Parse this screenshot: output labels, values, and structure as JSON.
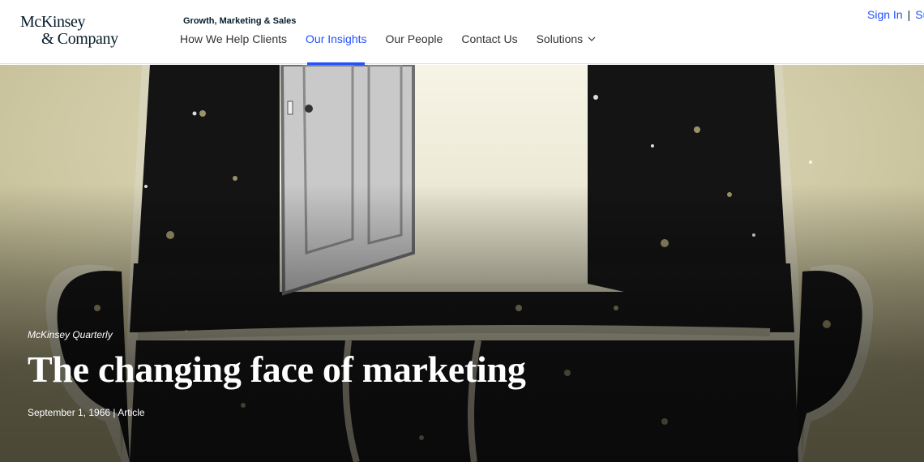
{
  "brand": {
    "logo_line1": "McKinsey",
    "logo_line2": "& Company"
  },
  "header": {
    "section_label": "Growth, Marketing & Sales",
    "nav": [
      {
        "label": "How We Help Clients",
        "active": false
      },
      {
        "label": "Our Insights",
        "active": true
      },
      {
        "label": "Our People",
        "active": false
      },
      {
        "label": "Contact Us",
        "active": false
      },
      {
        "label": "Solutions",
        "active": false,
        "dropdown": true
      }
    ],
    "utility": {
      "sign_in": "Sign In",
      "separator": "|",
      "subscribe_partial": "Su"
    }
  },
  "hero": {
    "eyebrow": "McKinsey Quarterly",
    "title": "The changing face of marketing",
    "meta": "September 1, 1966 | Article",
    "illustration": "armchair-with-open-door-icon"
  },
  "colors": {
    "accent": "#2251ff",
    "brand_dark": "#051c2c",
    "hero_bg": "#cfc9a6"
  }
}
